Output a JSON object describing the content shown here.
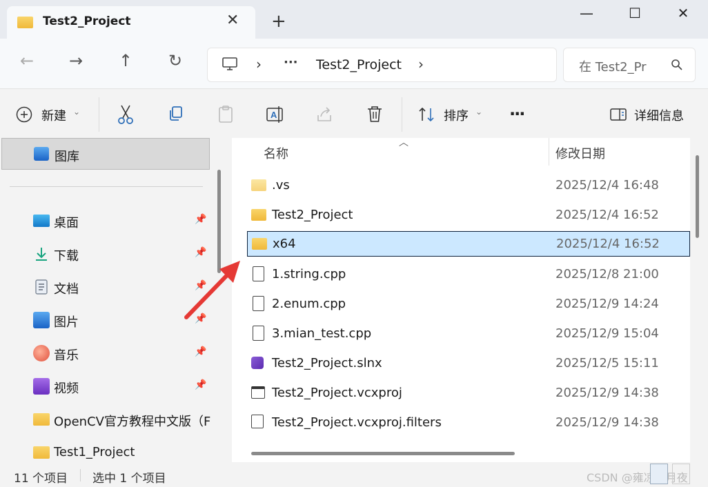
{
  "window": {
    "tab_title": "Test2_Project",
    "tab_close": "✕",
    "new_tab": "+",
    "minimize": "—",
    "maximize": "☐",
    "close": "✕"
  },
  "nav": {
    "back": "←",
    "forward": "→",
    "up": "↑",
    "refresh": "↻",
    "breadcrumb_more": "···",
    "breadcrumb_current": "Test2_Project",
    "search_placeholder": "在 Test2_Pr"
  },
  "toolbar": {
    "new_label": "新建",
    "sort_label": "排序",
    "more": "···",
    "details_label": "详细信息"
  },
  "sidebar": {
    "gallery": "图库",
    "items": [
      {
        "label": "桌面",
        "icon": "desktop-icon",
        "pinned": true
      },
      {
        "label": "下载",
        "icon": "download-icon",
        "pinned": true
      },
      {
        "label": "文档",
        "icon": "document-icon",
        "pinned": true
      },
      {
        "label": "图片",
        "icon": "pictures-icon",
        "pinned": true
      },
      {
        "label": "音乐",
        "icon": "music-icon",
        "pinned": true
      },
      {
        "label": "视频",
        "icon": "video-icon",
        "pinned": true
      },
      {
        "label": "OpenCV官方教程中文版（F",
        "icon": "folder-icon",
        "pinned": false
      },
      {
        "label": "Test1_Project",
        "icon": "folder-icon",
        "pinned": false
      }
    ]
  },
  "columns": {
    "name": "名称",
    "date": "修改日期"
  },
  "files": [
    {
      "name": ".vs",
      "date": "2025/12/4 16:48",
      "icon": "folder-icon"
    },
    {
      "name": "Test2_Project",
      "date": "2025/12/4 16:52",
      "icon": "folder-icon"
    },
    {
      "name": "x64",
      "date": "2025/12/4 16:52",
      "icon": "folder-icon",
      "selected": true
    },
    {
      "name": "1.string.cpp",
      "date": "2025/12/8 21:00",
      "icon": "cpp-file-icon"
    },
    {
      "name": "2.enum.cpp",
      "date": "2025/12/9 14:24",
      "icon": "cpp-file-icon"
    },
    {
      "name": "3.mian_test.cpp",
      "date": "2025/12/9 15:04",
      "icon": "cpp-file-icon"
    },
    {
      "name": "Test2_Project.slnx",
      "date": "2025/12/5 15:11",
      "icon": "solution-file-icon"
    },
    {
      "name": "Test2_Project.vcxproj",
      "date": "2025/12/9 14:38",
      "icon": "vcxproj-file-icon"
    },
    {
      "name": "Test2_Project.vcxproj.filters",
      "date": "2025/12/9 14:38",
      "icon": "filters-file-icon"
    }
  ],
  "status": {
    "count": "11 个项目",
    "selected": "选中 1 个项目"
  },
  "watermark": "CSDN @雍凉明月夜",
  "colors": {
    "selection_bg": "#cce8ff",
    "selection_border": "#0a1f3a",
    "arrow": "#e53935",
    "folder": "#f0b93a"
  }
}
